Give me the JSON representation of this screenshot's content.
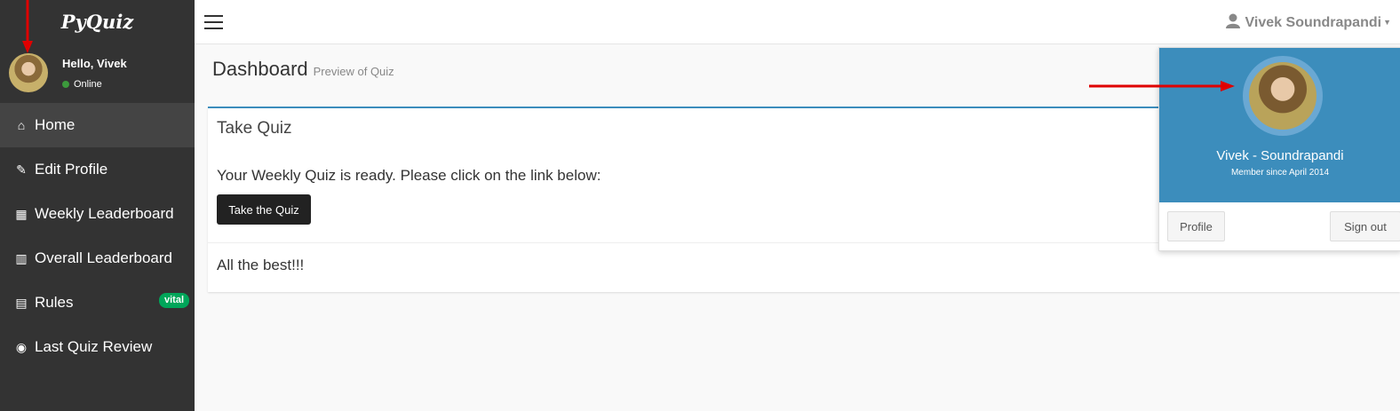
{
  "sidebar": {
    "brand": "PyQuiz",
    "greeting": "Hello, Vivek",
    "status": "Online",
    "items": [
      {
        "label": "Home",
        "icon": "home-icon",
        "glyph": "⌂"
      },
      {
        "label": "Edit Profile",
        "icon": "edit-icon",
        "glyph": "✎"
      },
      {
        "label": "Weekly Leaderboard",
        "icon": "table-icon",
        "glyph": "▦"
      },
      {
        "label": "Overall Leaderboard",
        "icon": "bar-chart-icon",
        "glyph": "▥"
      },
      {
        "label": "Rules",
        "icon": "book-icon",
        "glyph": "▤",
        "badge": "vital"
      },
      {
        "label": "Last Quiz Review",
        "icon": "eye-icon",
        "glyph": "◉"
      }
    ]
  },
  "header": {
    "user_name": "Vivek Soundrapandi"
  },
  "content": {
    "title": "Dashboard",
    "subtitle": "Preview of Quiz",
    "box_title": "Take Quiz",
    "box_text": "Your Weekly Quiz is ready. Please click on the link below:",
    "button_label": "Take the Quiz",
    "footer_text": "All the best!!!"
  },
  "dropdown": {
    "name": "Vivek - Soundrapandi",
    "member_since": "Member since April 2014",
    "profile_label": "Profile",
    "signout_label": "Sign out"
  },
  "colors": {
    "sidebar_bg": "#333333",
    "accent": "#3c8dbc",
    "badge": "#00a65a",
    "annotation": "#e00000"
  }
}
